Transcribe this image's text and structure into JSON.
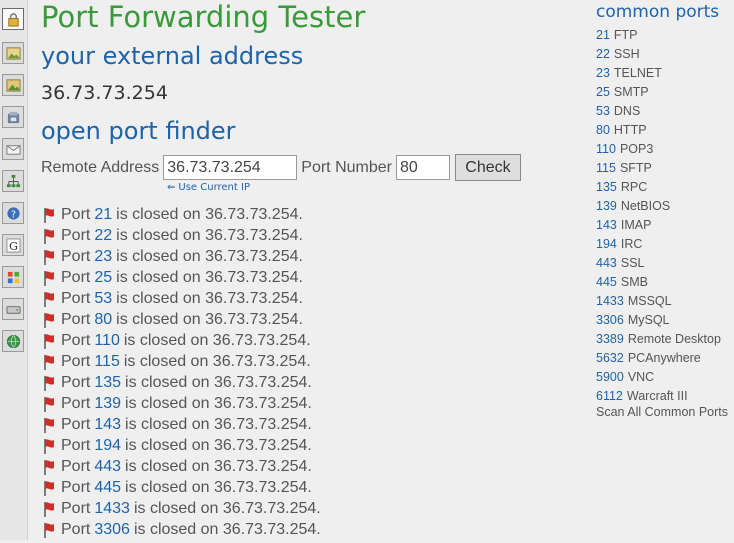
{
  "app": {
    "title": "Port Forwarding Tester",
    "external_heading": "your external address",
    "external_ip": "36.73.73.254",
    "finder_heading": "open port finder"
  },
  "form": {
    "remote_label": "Remote Address",
    "remote_value": "36.73.73.254",
    "port_label": "Port Number",
    "port_value": "80",
    "check_label": "Check",
    "use_current_ip": "Use Current IP"
  },
  "toolbar": {
    "icons": [
      "lock-icon",
      "image-icon",
      "image-icon",
      "phone-icon",
      "mail-icon",
      "sitemap-icon",
      "help-icon",
      "google-icon",
      "windows-icon",
      "drive-icon",
      "globe-icon"
    ]
  },
  "results": [
    {
      "prefix": "Port",
      "port": "21",
      "suffix": "is closed on 36.73.73.254."
    },
    {
      "prefix": "Port",
      "port": "22",
      "suffix": "is closed on 36.73.73.254."
    },
    {
      "prefix": "Port",
      "port": "23",
      "suffix": "is closed on 36.73.73.254."
    },
    {
      "prefix": "Port",
      "port": "25",
      "suffix": "is closed on 36.73.73.254."
    },
    {
      "prefix": "Port",
      "port": "53",
      "suffix": "is closed on 36.73.73.254."
    },
    {
      "prefix": "Port",
      "port": "80",
      "suffix": "is closed on 36.73.73.254."
    },
    {
      "prefix": "Port",
      "port": "110",
      "suffix": "is closed on 36.73.73.254."
    },
    {
      "prefix": "Port",
      "port": "115",
      "suffix": "is closed on 36.73.73.254."
    },
    {
      "prefix": "Port",
      "port": "135",
      "suffix": "is closed on 36.73.73.254."
    },
    {
      "prefix": "Port",
      "port": "139",
      "suffix": "is closed on 36.73.73.254."
    },
    {
      "prefix": "Port",
      "port": "143",
      "suffix": "is closed on 36.73.73.254."
    },
    {
      "prefix": "Port",
      "port": "194",
      "suffix": "is closed on 36.73.73.254."
    },
    {
      "prefix": "Port",
      "port": "443",
      "suffix": "is closed on 36.73.73.254."
    },
    {
      "prefix": "Port",
      "port": "445",
      "suffix": "is closed on 36.73.73.254."
    },
    {
      "prefix": "Port",
      "port": "1433",
      "suffix": "is closed on 36.73.73.254."
    },
    {
      "prefix": "Port",
      "port": "3306",
      "suffix": "is closed on 36.73.73.254."
    }
  ],
  "sidebar": {
    "title": "common ports",
    "ports": [
      {
        "num": "21",
        "name": "FTP"
      },
      {
        "num": "22",
        "name": "SSH"
      },
      {
        "num": "23",
        "name": "TELNET"
      },
      {
        "num": "25",
        "name": "SMTP"
      },
      {
        "num": "53",
        "name": "DNS"
      },
      {
        "num": "80",
        "name": "HTTP"
      },
      {
        "num": "110",
        "name": "POP3"
      },
      {
        "num": "115",
        "name": "SFTP"
      },
      {
        "num": "135",
        "name": "RPC"
      },
      {
        "num": "139",
        "name": "NetBIOS"
      },
      {
        "num": "143",
        "name": "IMAP"
      },
      {
        "num": "194",
        "name": "IRC"
      },
      {
        "num": "443",
        "name": "SSL"
      },
      {
        "num": "445",
        "name": "SMB"
      },
      {
        "num": "1433",
        "name": "MSSQL"
      },
      {
        "num": "3306",
        "name": "MySQL"
      },
      {
        "num": "3389",
        "name": "Remote Desktop"
      },
      {
        "num": "5632",
        "name": "PCAnywhere"
      },
      {
        "num": "5900",
        "name": "VNC"
      },
      {
        "num": "6112",
        "name": "Warcraft III"
      }
    ],
    "scan_all": "Scan All Common Ports"
  },
  "colors": {
    "title_green": "#3a9a3a",
    "heading_blue": "#1e63a8",
    "link_blue": "#1e63a8",
    "flag_red": "#c8322a"
  }
}
